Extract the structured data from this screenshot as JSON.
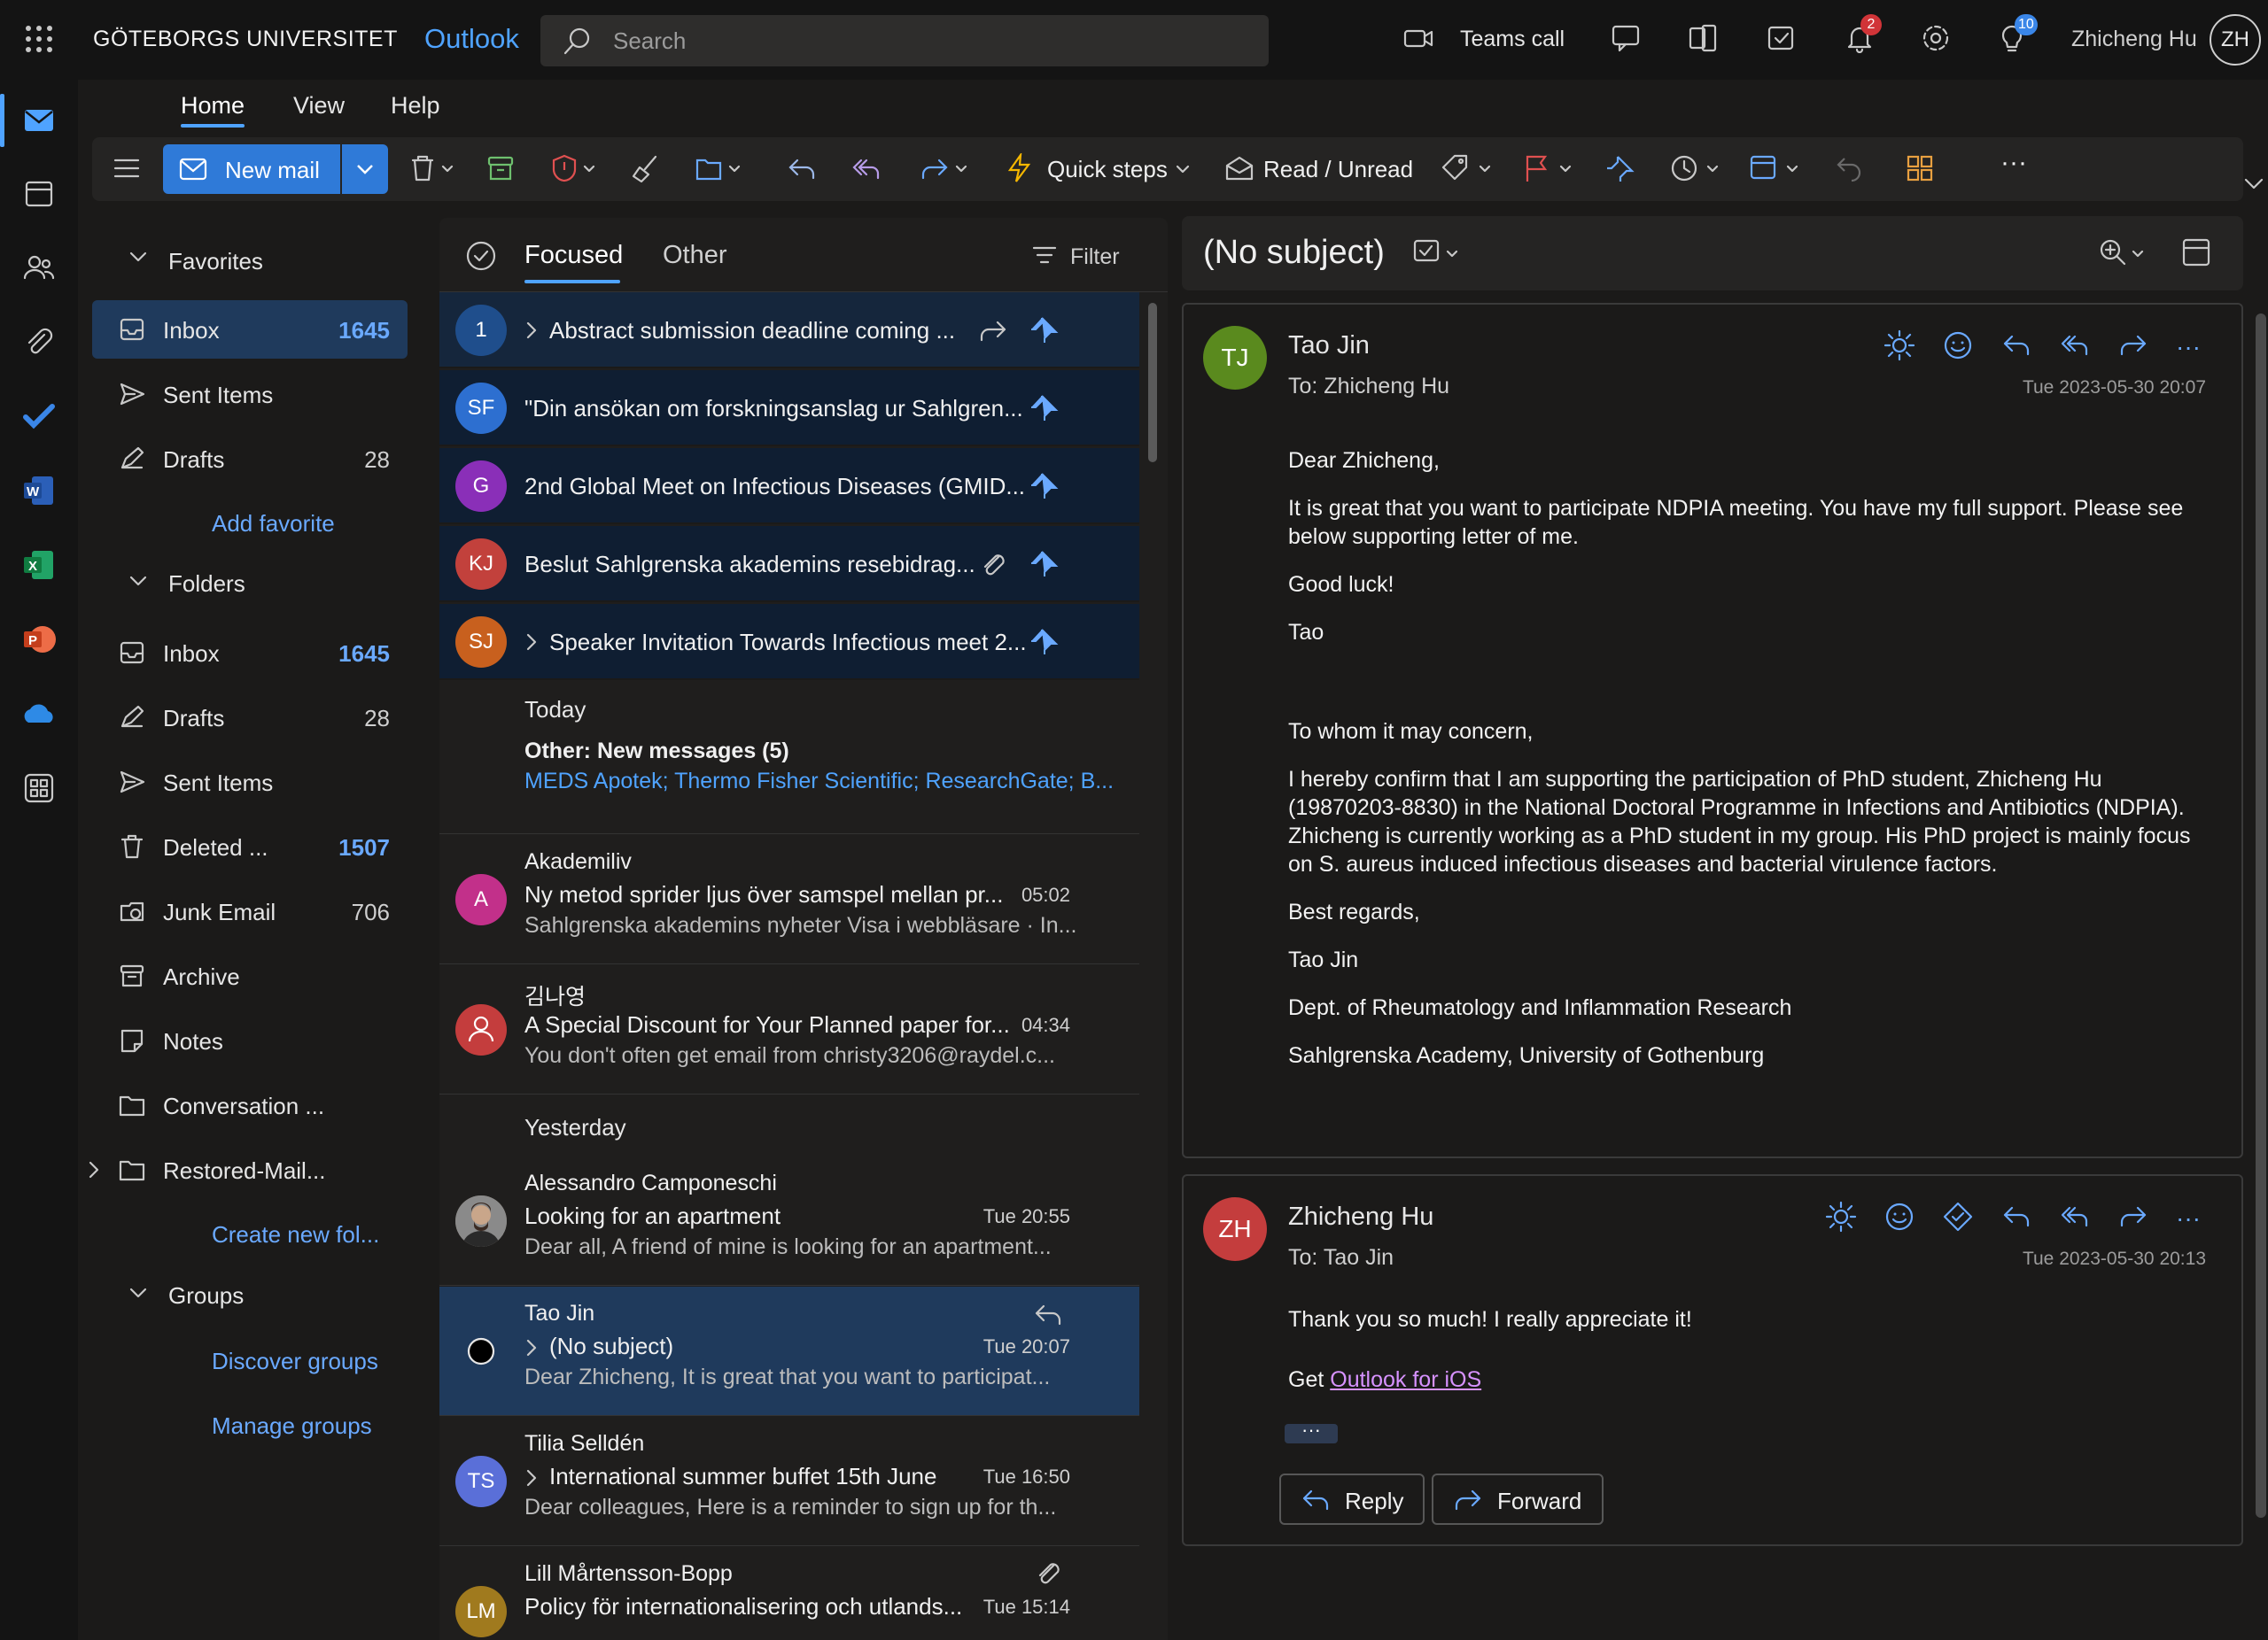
{
  "topbar": {
    "org": "GÖTEBORGS UNIVERSITET",
    "app": "Outlook",
    "search_placeholder": "Search",
    "teams_call": "Teams call",
    "notifications_count": "2",
    "tips_count": "10",
    "user_name": "Zhicheng Hu",
    "user_initials": "ZH"
  },
  "tabs": [
    "Home",
    "View",
    "Help"
  ],
  "ribbon": {
    "new_mail": "New mail",
    "quick_steps": "Quick steps",
    "read_unread": "Read / Unread",
    "more": "···"
  },
  "folders": {
    "favorites_label": "Favorites",
    "favorites": [
      {
        "label": "Inbox",
        "count": "1645"
      },
      {
        "label": "Sent Items",
        "count": ""
      },
      {
        "label": "Drafts",
        "count": "28"
      }
    ],
    "add_favorite": "Add favorite",
    "folders_label": "Folders",
    "items": [
      {
        "label": "Inbox",
        "count": "1645"
      },
      {
        "label": "Drafts",
        "count": "28"
      },
      {
        "label": "Sent Items",
        "count": ""
      },
      {
        "label": "Deleted ...",
        "count": "1507"
      },
      {
        "label": "Junk Email",
        "count": "706"
      },
      {
        "label": "Archive",
        "count": ""
      },
      {
        "label": "Notes",
        "count": ""
      },
      {
        "label": "Conversation ...",
        "count": ""
      },
      {
        "label": "Restored-Mail...",
        "count": ""
      }
    ],
    "create_new": "Create new fol...",
    "groups_label": "Groups",
    "discover_groups": "Discover groups",
    "manage_groups": "Manage groups"
  },
  "list": {
    "tab_focused": "Focused",
    "tab_other": "Other",
    "filter": "Filter",
    "pinned": [
      {
        "initials": "1",
        "color": "#1f4e8c",
        "subject": "Abstract submission deadline coming ..."
      },
      {
        "initials": "SF",
        "color": "#2d6fd0",
        "subject": "\"Din ansökan om forskningsanslag ur Sahlgren..."
      },
      {
        "initials": "G",
        "color": "#8a2fb8",
        "subject": "2nd Global Meet on Infectious Diseases (GMID..."
      },
      {
        "initials": "KJ",
        "color": "#c2413c",
        "subject": "Beslut Sahlgrenska akademins resebidrag..."
      },
      {
        "initials": "SJ",
        "color": "#c8601e",
        "subject": "Speaker Invitation Towards Infectious meet 2..."
      }
    ],
    "today_label": "Today",
    "other_new": "Other: New messages (5)",
    "other_senders": "MEDS Apotek; Thermo Fisher Scientific; ResearchGate; B...",
    "messages_today": [
      {
        "initials": "A",
        "color": "#c2308a",
        "from": "Akademiliv",
        "subject": "Ny metod sprider ljus över samspel mellan pr...",
        "time": "05:02",
        "preview": "Sahlgrenska akademins nyheter Visa i webbläsare · In..."
      },
      {
        "initials": "",
        "color": "#c43d3d",
        "from": "김나영",
        "subject": "A Special Discount for Your Planned paper for...",
        "time": "04:34",
        "preview": "You don't often get email from christy3206@raydel.c..."
      }
    ],
    "yesterday_label": "Yesterday",
    "messages_yesterday": [
      {
        "initials": "",
        "color": "#6b5a4a",
        "from": "Alessandro Camponeschi",
        "subject": "Looking for an apartment",
        "time": "Tue 20:55",
        "preview": "Dear all, A friend of mine is looking for an apartment..."
      },
      {
        "initials": "",
        "color": "#000000",
        "from": "Tao Jin",
        "subject": "(No subject)",
        "time": "Tue 20:07",
        "preview": "Dear Zhicheng, It is great that you want to participat..."
      },
      {
        "initials": "TS",
        "color": "#5a6fd8",
        "from": "Tilia Selldén",
        "subject": "International summer buffet 15th June",
        "time": "Tue 16:50",
        "preview": "Dear colleagues, Here is a reminder to sign up for th..."
      },
      {
        "initials": "LM",
        "color": "#a07a1e",
        "from": "Lill Mårtensson-Bopp",
        "subject": "Policy för internationalisering och utlands...",
        "time": "Tue 15:14",
        "preview": ""
      }
    ]
  },
  "reading": {
    "subject": "(No subject)",
    "message1": {
      "initials": "TJ",
      "color": "#5a8a1e",
      "from": "Tao Jin",
      "to": "To:  Zhicheng Hu",
      "date": "Tue 2023-05-30 20:07",
      "body": [
        "Dear Zhicheng,",
        "It is great that you want to participate NDPIA meeting. You have my full support. Please see below supporting letter of me.",
        "Good luck!",
        "Tao",
        "",
        "To whom it may concern,",
        "I hereby confirm that I am supporting the participation of PhD student, Zhicheng Hu (19870203-8830) in the National Doctoral Programme in Infections and Antibiotics (NDPIA). Zhicheng is currently working as a PhD student in my group. His PhD project is mainly focus on S. aureus induced infectious diseases and bacterial virulence factors.",
        "Best regards,",
        "Tao Jin",
        "Dept. of Rheumatology and Inflammation Research",
        "Sahlgrenska Academy, University of Gothenburg"
      ]
    },
    "message2": {
      "initials": "ZH",
      "color": "#c43d3d",
      "from": "Zhicheng Hu",
      "to": "To:  Tao Jin",
      "date": "Tue 2023-05-30 20:13",
      "body": "Thank you so much! I really appreciate it!",
      "get_prefix": "Get ",
      "link": "Outlook for iOS",
      "dots": "···",
      "reply": "Reply",
      "forward": "Forward"
    }
  }
}
